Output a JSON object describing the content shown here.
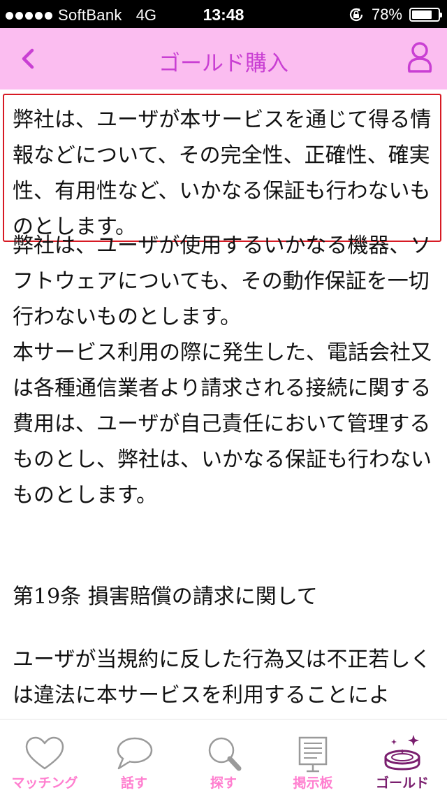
{
  "status_bar": {
    "carrier": "SoftBank",
    "network": "4G",
    "time": "13:48",
    "battery_percent": "78%",
    "battery_level": 0.78
  },
  "nav": {
    "title": "ゴールド購入",
    "back_icon": "chevron-left-icon",
    "user_icon": "user-icon"
  },
  "content": {
    "highlighted_paragraph": "弊社は、ユーザが本サービスを通じて得る情報などについて、その完全性、正確性、確実性、有用性など、いかなる保証も行わないものとします。",
    "paragraphs": [
      "弊社は、ユーザが使用するいかなる機器、ソフトウェアについても、その動作保証を一切行わないものとします。",
      "本サービス利用の際に発生した、電話会社又は各種通信業者より請求される接続に関する費用は、ユーザが自己責任において管理するものとし、弊社は、いかなる保証も行わないものとします。"
    ],
    "article_heading": "第19条 損害賠償の請求に関して",
    "article_text": "ユーザが当規約に反した行為又は不正若しくは違法に本サービスを利用することによ"
  },
  "tabs": [
    {
      "label": "マッチング",
      "icon": "heart-icon",
      "active": false
    },
    {
      "label": "話す",
      "icon": "speech-bubble-icon",
      "active": false
    },
    {
      "label": "探す",
      "icon": "search-icon",
      "active": false
    },
    {
      "label": "掲示板",
      "icon": "bulletin-board-icon",
      "active": false
    },
    {
      "label": "ゴールド",
      "icon": "gold-coin-icon",
      "active": true
    }
  ],
  "colors": {
    "nav_background": "#fbbdf0",
    "accent": "#c93fd3",
    "active_tab": "#7a1e6e",
    "inactive_tab_icon": "#9a9a9a",
    "inactive_tab_label": "#ff7ecf",
    "highlight_border": "#d71a24"
  }
}
